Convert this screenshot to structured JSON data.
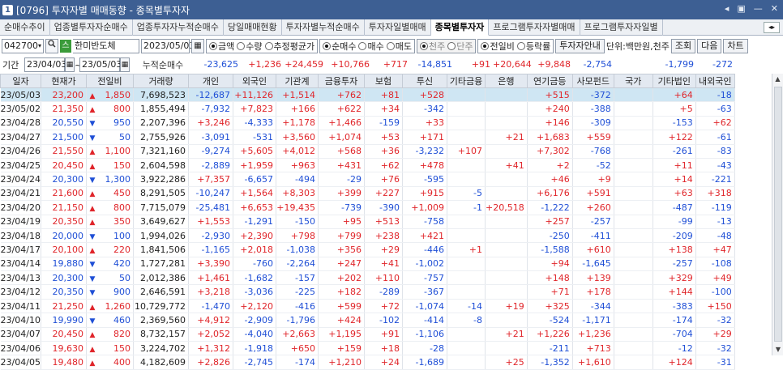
{
  "window": {
    "badge": "1",
    "title": "[0796] 투자자별 매매동향 - 종목별투자자",
    "controls": [
      "◂",
      "▣",
      "—",
      "✕"
    ]
  },
  "tabs": [
    "순매수추이",
    "업종별투자자순매수",
    "업종투자자누적순매수",
    "당일매매현황",
    "투자자별누적순매수",
    "투자자일별매매",
    "종목별투자자",
    "프로그램투자자별매매",
    "프로그램투자자일별"
  ],
  "active_tab": 6,
  "tabnav": "◂▸",
  "toolbar": {
    "code": "042700",
    "code_arrow": "▾",
    "search_icon": "🔍",
    "market_badge": "스",
    "stock_name": "한미반도체",
    "date": "2023/05/03",
    "cal_icon": "▦",
    "opt1": [
      {
        "label": "금액",
        "on": true
      },
      {
        "label": "수량",
        "on": false
      },
      {
        "label": "추정평균가",
        "on": false
      }
    ],
    "opt2": [
      {
        "label": "순매수",
        "on": true
      },
      {
        "label": "매수",
        "on": false
      },
      {
        "label": "매도",
        "on": false
      }
    ],
    "opt3": [
      {
        "label": "천주",
        "on": true
      },
      {
        "label": "단주",
        "on": false
      }
    ],
    "opt4": [
      {
        "label": "전일비",
        "on": true
      },
      {
        "label": "등락률",
        "on": false
      }
    ],
    "info_btn": "투자자안내",
    "unit": "단위:백만원,천주",
    "query_btn": "조회",
    "next_btn": "다음",
    "chart_btn": "차트"
  },
  "period": {
    "label": "기간",
    "from": "23/04/03",
    "sep": "~",
    "to": "23/05/03",
    "cum_label": "누적순매수",
    "sums": [
      {
        "v": "-23,625",
        "c": "blue"
      },
      {
        "v": "+1,236",
        "c": "red"
      },
      {
        "v": "+24,459",
        "c": "red"
      },
      {
        "v": "+10,766",
        "c": "red"
      },
      {
        "v": "+717",
        "c": "red"
      },
      {
        "v": "-14,851",
        "c": "blue"
      },
      {
        "v": "+91",
        "c": "red"
      },
      {
        "v": "+20,644",
        "c": "red"
      },
      {
        "v": "+9,848",
        "c": "red"
      },
      {
        "v": "-2,754",
        "c": "blue"
      },
      {
        "v": "",
        "c": ""
      },
      {
        "v": "-1,799",
        "c": "blue"
      },
      {
        "v": "-272",
        "c": "blue"
      }
    ]
  },
  "headers": [
    "일자",
    "현재가",
    "전일비",
    "거래량",
    "개인",
    "외국인",
    "기관계",
    "금융투자",
    "보험",
    "투신",
    "기타금융",
    "은행",
    "연기금등",
    "사모펀드",
    "국가",
    "기타법인",
    "내외국인"
  ],
  "rows": [
    [
      "23/05/03",
      "23,200",
      "▲",
      "1,850",
      "7,698,523",
      "-12,687",
      "+11,126",
      "+1,514",
      "+762",
      "+81",
      "+528",
      "",
      "",
      "+515",
      "-372",
      "",
      "+64",
      "-18"
    ],
    [
      "23/05/02",
      "21,350",
      "▲",
      "800",
      "1,855,494",
      "-7,932",
      "+7,823",
      "+166",
      "+622",
      "+34",
      "-342",
      "",
      "",
      "+240",
      "-388",
      "",
      "+5",
      "-63"
    ],
    [
      "23/04/28",
      "20,550",
      "▼",
      "950",
      "2,207,396",
      "+3,246",
      "-4,333",
      "+1,178",
      "+1,466",
      "-159",
      "+33",
      "",
      "",
      "+146",
      "-309",
      "",
      "-153",
      "+62"
    ],
    [
      "23/04/27",
      "21,500",
      "▼",
      "50",
      "2,755,926",
      "-3,091",
      "-531",
      "+3,560",
      "+1,074",
      "+53",
      "+171",
      "",
      "+21",
      "+1,683",
      "+559",
      "",
      "+122",
      "-61"
    ],
    [
      "23/04/26",
      "21,550",
      "▲",
      "1,100",
      "7,321,160",
      "-9,274",
      "+5,605",
      "+4,012",
      "+568",
      "+36",
      "-3,232",
      "+107",
      "",
      "+7,302",
      "-768",
      "",
      "-261",
      "-83"
    ],
    [
      "23/04/25",
      "20,450",
      "▲",
      "150",
      "2,604,598",
      "-2,889",
      "+1,959",
      "+963",
      "+431",
      "+62",
      "+478",
      "",
      "+41",
      "+2",
      "-52",
      "",
      "+11",
      "-43"
    ],
    [
      "23/04/24",
      "20,300",
      "▼",
      "1,300",
      "3,922,286",
      "+7,357",
      "-6,657",
      "-494",
      "-29",
      "+76",
      "-595",
      "",
      "",
      "+46",
      "+9",
      "",
      "+14",
      "-221"
    ],
    [
      "23/04/21",
      "21,600",
      "▲",
      "450",
      "8,291,505",
      "-10,247",
      "+1,564",
      "+8,303",
      "+399",
      "+227",
      "+915",
      "-5",
      "",
      "+6,176",
      "+591",
      "",
      "+63",
      "+318"
    ],
    [
      "23/04/20",
      "21,150",
      "▲",
      "800",
      "7,715,079",
      "-25,481",
      "+6,653",
      "+19,435",
      "-739",
      "-390",
      "+1,009",
      "-1",
      "+20,518",
      "-1,222",
      "+260",
      "",
      "-487",
      "-119"
    ],
    [
      "23/04/19",
      "20,350",
      "▲",
      "350",
      "3,649,627",
      "+1,553",
      "-1,291",
      "-150",
      "+95",
      "+513",
      "-758",
      "",
      "",
      "+257",
      "-257",
      "",
      "-99",
      "-13"
    ],
    [
      "23/04/18",
      "20,000",
      "▼",
      "100",
      "1,994,026",
      "-2,930",
      "+2,390",
      "+798",
      "+799",
      "+238",
      "+421",
      "",
      "",
      "-250",
      "-411",
      "",
      "-209",
      "-48"
    ],
    [
      "23/04/17",
      "20,100",
      "▲",
      "220",
      "1,841,506",
      "-1,165",
      "+2,018",
      "-1,038",
      "+356",
      "+29",
      "-446",
      "+1",
      "",
      "-1,588",
      "+610",
      "",
      "+138",
      "+47"
    ],
    [
      "23/04/14",
      "19,880",
      "▼",
      "420",
      "1,727,281",
      "+3,390",
      "-760",
      "-2,264",
      "+247",
      "+41",
      "-1,002",
      "",
      "",
      "+94",
      "-1,645",
      "",
      "-257",
      "-108"
    ],
    [
      "23/04/13",
      "20,300",
      "▼",
      "50",
      "2,012,386",
      "+1,461",
      "-1,682",
      "-157",
      "+202",
      "+110",
      "-757",
      "",
      "",
      "+148",
      "+139",
      "",
      "+329",
      "+49"
    ],
    [
      "23/04/12",
      "20,350",
      "▼",
      "900",
      "2,646,591",
      "+3,218",
      "-3,036",
      "-225",
      "+182",
      "-289",
      "-367",
      "",
      "",
      "+71",
      "+178",
      "",
      "+144",
      "-100"
    ],
    [
      "23/04/11",
      "21,250",
      "▲",
      "1,260",
      "10,729,772",
      "-1,470",
      "+2,120",
      "-416",
      "+599",
      "+72",
      "-1,074",
      "-14",
      "+19",
      "+325",
      "-344",
      "",
      "-383",
      "+150"
    ],
    [
      "23/04/10",
      "19,990",
      "▼",
      "460",
      "2,369,560",
      "+4,912",
      "-2,909",
      "-1,796",
      "+424",
      "-102",
      "-414",
      "-8",
      "",
      "-524",
      "-1,171",
      "",
      "-174",
      "-32"
    ],
    [
      "23/04/07",
      "20,450",
      "▲",
      "820",
      "8,732,157",
      "+2,052",
      "-4,040",
      "+2,663",
      "+1,195",
      "+91",
      "-1,106",
      "",
      "+21",
      "+1,226",
      "+1,236",
      "",
      "-704",
      "+29"
    ],
    [
      "23/04/06",
      "19,630",
      "▲",
      "150",
      "3,224,702",
      "+1,312",
      "-1,918",
      "+650",
      "+159",
      "+18",
      "-28",
      "",
      "",
      "-211",
      "+713",
      "",
      "-12",
      "-32"
    ],
    [
      "23/04/05",
      "19,480",
      "▲",
      "400",
      "4,182,609",
      "+2,826",
      "-2,745",
      "-174",
      "+1,210",
      "+24",
      "-1,689",
      "",
      "+25",
      "-1,352",
      "+1,610",
      "",
      "+124",
      "-31"
    ]
  ],
  "scrollbar": {
    "up": "▲",
    "down": "▼"
  },
  "colors": {
    "up": "#e0252a",
    "down": "#1f4fd6",
    "selected_row": "#cfe6f3",
    "titlebar": "#3d5f93"
  }
}
